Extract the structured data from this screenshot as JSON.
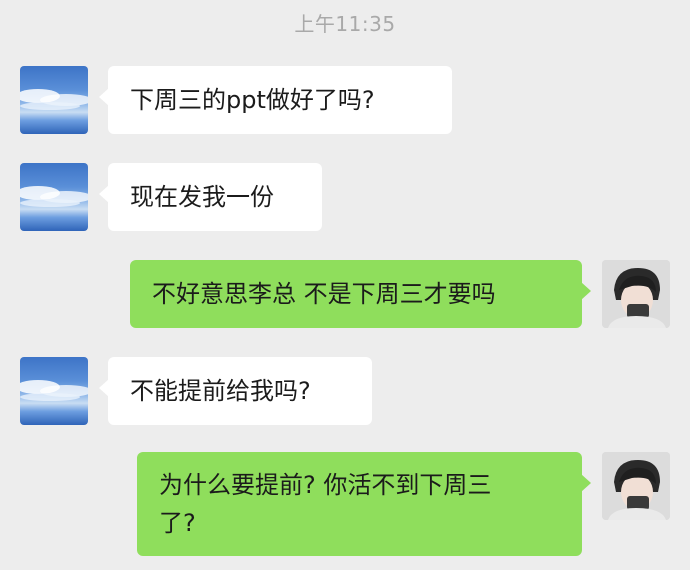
{
  "timestamp": "上午11:35",
  "messages": [
    {
      "side": "in",
      "text": "下周三的ppt做好了吗?"
    },
    {
      "side": "in",
      "text": "现在发我一份"
    },
    {
      "side": "out",
      "text": "不好意思李总 不是下周三才要吗"
    },
    {
      "side": "in",
      "text": "不能提前给我吗?"
    },
    {
      "side": "out",
      "text": "为什么要提前? 你活不到下周三\n了?"
    }
  ],
  "colors": {
    "background": "#ededed",
    "incoming_bubble": "#ffffff",
    "outgoing_bubble": "#8fde5c",
    "timestamp_text": "#a9a9a9"
  },
  "icons": {
    "contact_avatar": "sky-avatar-icon",
    "self_avatar": "boy-avatar-icon"
  }
}
